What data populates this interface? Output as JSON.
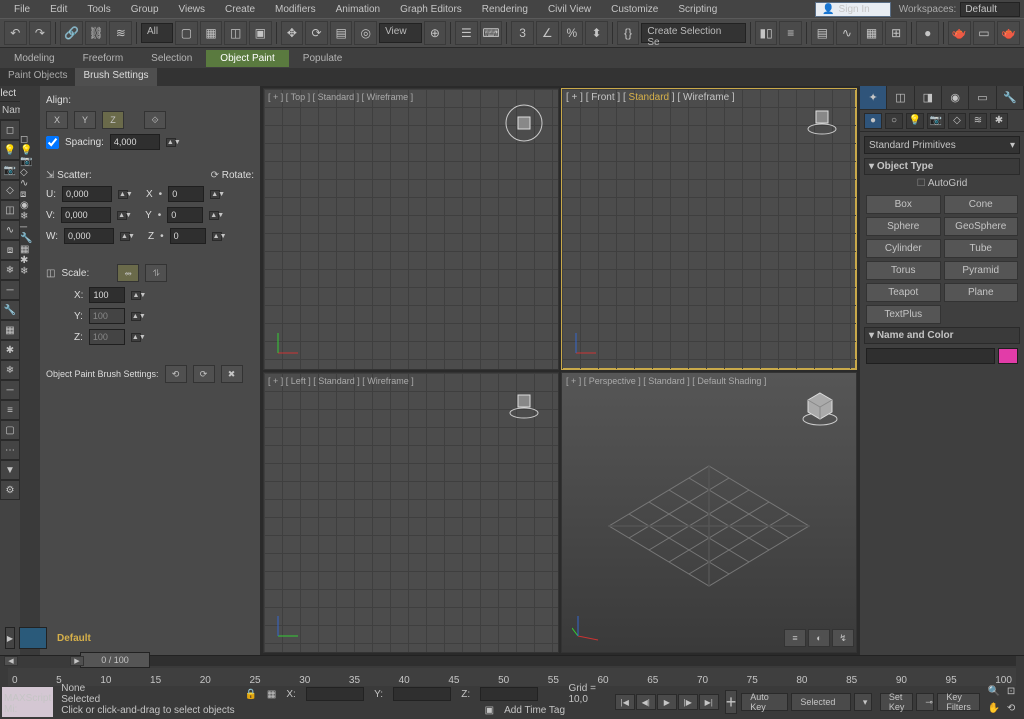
{
  "menubar": {
    "items": [
      "File",
      "Edit",
      "Tools",
      "Group",
      "Views",
      "Create",
      "Modifiers",
      "Animation",
      "Graph Editors",
      "Rendering",
      "Civil View",
      "Customize",
      "Scripting"
    ],
    "signin": "Sign In",
    "workspace_label": "Workspaces:",
    "workspace_value": "Default"
  },
  "toolbar1": {
    "all_filter": "All",
    "view_label": "View",
    "selection_set": "Create Selection Se"
  },
  "ribbon": {
    "tabs": [
      "Modeling",
      "Freeform",
      "Selection",
      "Object Paint",
      "Populate"
    ],
    "active": 3
  },
  "subtabs": {
    "tabs": [
      "Paint Objects",
      "Brush Settings"
    ],
    "active": 1
  },
  "left": {
    "select_label": "Select",
    "name_label": "Nam",
    "align_title": "Align:",
    "axes": [
      "X",
      "Y",
      "Z"
    ],
    "spacing_label": "Spacing:",
    "spacing_value": "4,000",
    "scatter_label": "Scatter:",
    "rotate_label": "Rotate:",
    "u": "0,000",
    "v": "0,000",
    "w": "0,000",
    "rx": "0",
    "ry": "0",
    "rz": "0",
    "rx_lbl": "X",
    "ry_lbl": "Y",
    "rz_lbl": "Z",
    "u_lbl": "U:",
    "v_lbl": "V:",
    "w_lbl": "W:",
    "scale_label": "Scale:",
    "sx": "100",
    "sy": "100",
    "sz": "100",
    "sx_lbl": "X:",
    "sy_lbl": "Y:",
    "sz_lbl": "Z:",
    "brush_settings_label": "Object Paint Brush Settings:"
  },
  "viewports": {
    "top": "[ + ] [ Top ] [ Standard ] [ Wireframe ]",
    "front_a": "[ + ] [ Front ] [ ",
    "front_b": "Standard",
    "front_c": " ] [ Wireframe ]",
    "left": "[ + ] [ Left ] [ Standard ] [ Wireframe ]",
    "persp": "[ + ] [ Perspective ] [ Standard ] [ Default Shading ]"
  },
  "cmd": {
    "dropdown": "Standard Primitives",
    "rollout_type": "Object Type",
    "autogrid": "AutoGrid",
    "objects": [
      "Box",
      "Cone",
      "Sphere",
      "GeoSphere",
      "Cylinder",
      "Tube",
      "Torus",
      "Pyramid",
      "Teapot",
      "Plane",
      "TextPlus",
      ""
    ],
    "rollout_name": "Name and Color"
  },
  "timeline": {
    "slider_label": "0 / 100",
    "ticks": [
      "0",
      "5",
      "10",
      "15",
      "20",
      "25",
      "30",
      "35",
      "40",
      "45",
      "50",
      "55",
      "60",
      "65",
      "70",
      "75",
      "80",
      "85",
      "90",
      "95",
      "100"
    ],
    "layer": "Default"
  },
  "status": {
    "none": "None Selected",
    "hint": "Click or click-and-drag to select objects",
    "mxs": "MAXScript Mi:",
    "x": "X:",
    "y": "Y:",
    "z": "Z:",
    "grid": "Grid = 10,0",
    "addtime": "Add Time Tag",
    "autokey": "Auto Key",
    "selected": "Selected",
    "setkey": "Set Key",
    "keyfilters": "Key Filters"
  }
}
